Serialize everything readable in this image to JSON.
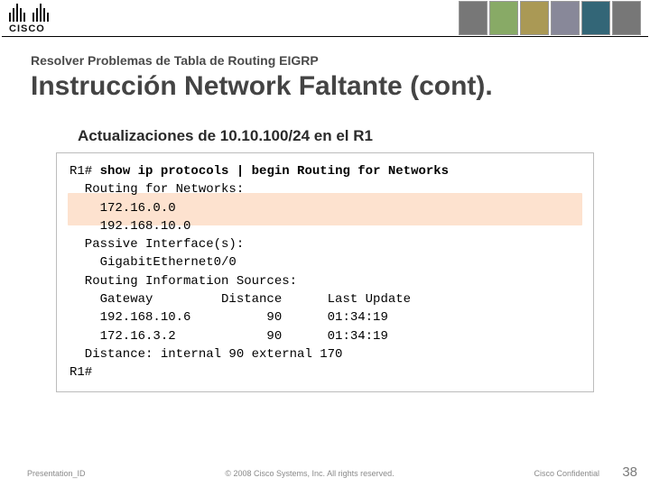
{
  "brand": {
    "name": "CISCO"
  },
  "header": {
    "kicker": "Resolver Problemas de Tabla de Routing EIGRP",
    "title": "Instrucción Network Faltante (cont).",
    "subhead": "Actualizaciones de 10.10.100/24 en el R1"
  },
  "terminal": {
    "prompt1": "R1#",
    "command": " show ip protocols | begin Routing for Networks",
    "lines": [
      "  Routing for Networks:",
      "    172.16.0.0",
      "    192.168.10.0",
      "  Passive Interface(s):",
      "    GigabitEthernet0/0",
      "  Routing Information Sources:",
      "    Gateway         Distance      Last Update",
      "    192.168.10.6          90      01:34:19",
      "    172.16.3.2            90      01:34:19",
      "  Distance: internal 90 external 170",
      "",
      "R1#"
    ]
  },
  "footer": {
    "left": "Presentation_ID",
    "center": "© 2008 Cisco Systems, Inc. All rights reserved.",
    "right": "Cisco Confidential",
    "page": "38"
  }
}
